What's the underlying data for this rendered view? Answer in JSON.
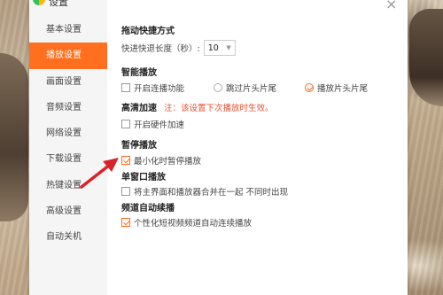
{
  "window": {
    "title": "设置",
    "close_label": "×"
  },
  "sidebar": {
    "items": [
      {
        "label": "基本设置",
        "active": false
      },
      {
        "label": "播放设置",
        "active": true
      },
      {
        "label": "画面设置",
        "active": false
      },
      {
        "label": "音频设置",
        "active": false
      },
      {
        "label": "网络设置",
        "active": false
      },
      {
        "label": "下载设置",
        "active": false
      },
      {
        "label": "热键设置",
        "active": false
      },
      {
        "label": "高级设置",
        "active": false
      },
      {
        "label": "自动关机",
        "active": false
      }
    ]
  },
  "sections": {
    "seek": {
      "title": "拖动快捷方式",
      "label": "快进快退长度（秒）:",
      "value": "10"
    },
    "smart": {
      "title": "智能播放",
      "option1": "开启连播功能",
      "option2": "跳过片头片尾",
      "option3": "播放片头片尾"
    },
    "hd": {
      "title": "高清加速",
      "note": "注：该设置下次播放时生效。",
      "option": "开启硬件加速"
    },
    "pause": {
      "title": "暂停播放",
      "option": "最小化时暂停播放"
    },
    "single": {
      "title": "单窗口播放",
      "option": "将主界面和播放器合并在一起 不同时出现"
    },
    "channel": {
      "title": "频道自动续播",
      "option": "个性化短视频频道自动连续播放"
    }
  },
  "colors": {
    "accent": "#ff6f1e",
    "note": "#e8502e",
    "arrow": "#d8232a"
  }
}
